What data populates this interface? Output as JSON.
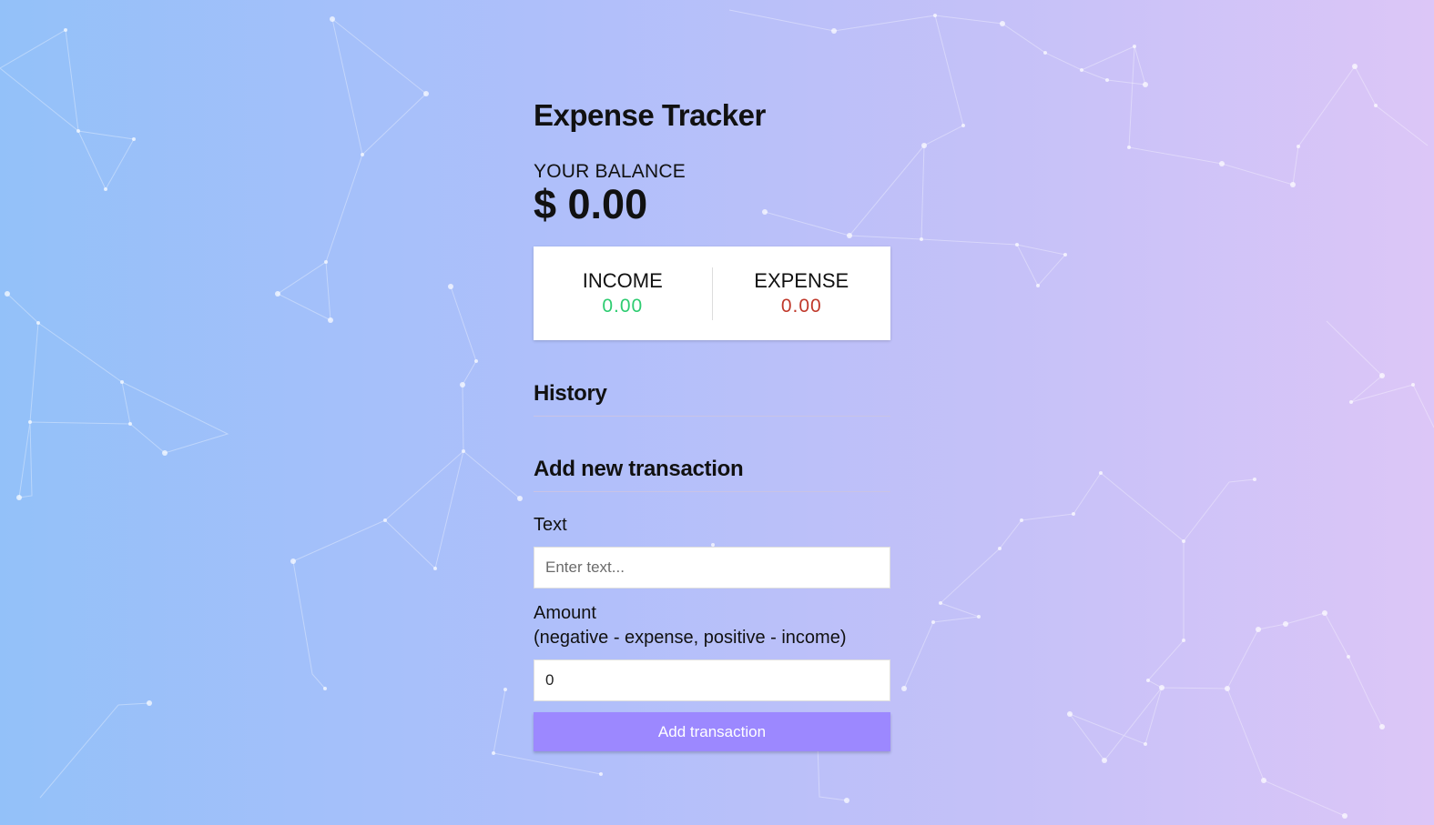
{
  "app": {
    "title": "Expense Tracker"
  },
  "balance": {
    "label": "YOUR BALANCE",
    "value": "$ 0.00"
  },
  "summary": {
    "income_label": "INCOME",
    "income_value": "0.00",
    "expense_label": "EXPENSE",
    "expense_value": "0.00",
    "income_color": "#2ecc71",
    "expense_color": "#c0392b"
  },
  "history": {
    "title": "History",
    "items": []
  },
  "form": {
    "title": "Add new transaction",
    "text_label": "Text",
    "text_placeholder": "Enter text...",
    "text_value": "",
    "amount_label_line1": "Amount",
    "amount_label_line2": "(negative - expense, positive - income)",
    "amount_value": "0",
    "submit_label": "Add transaction"
  },
  "colors": {
    "background_start": "#93c1f9",
    "background_end": "#dcc6f7",
    "button": "#9c88ff"
  }
}
